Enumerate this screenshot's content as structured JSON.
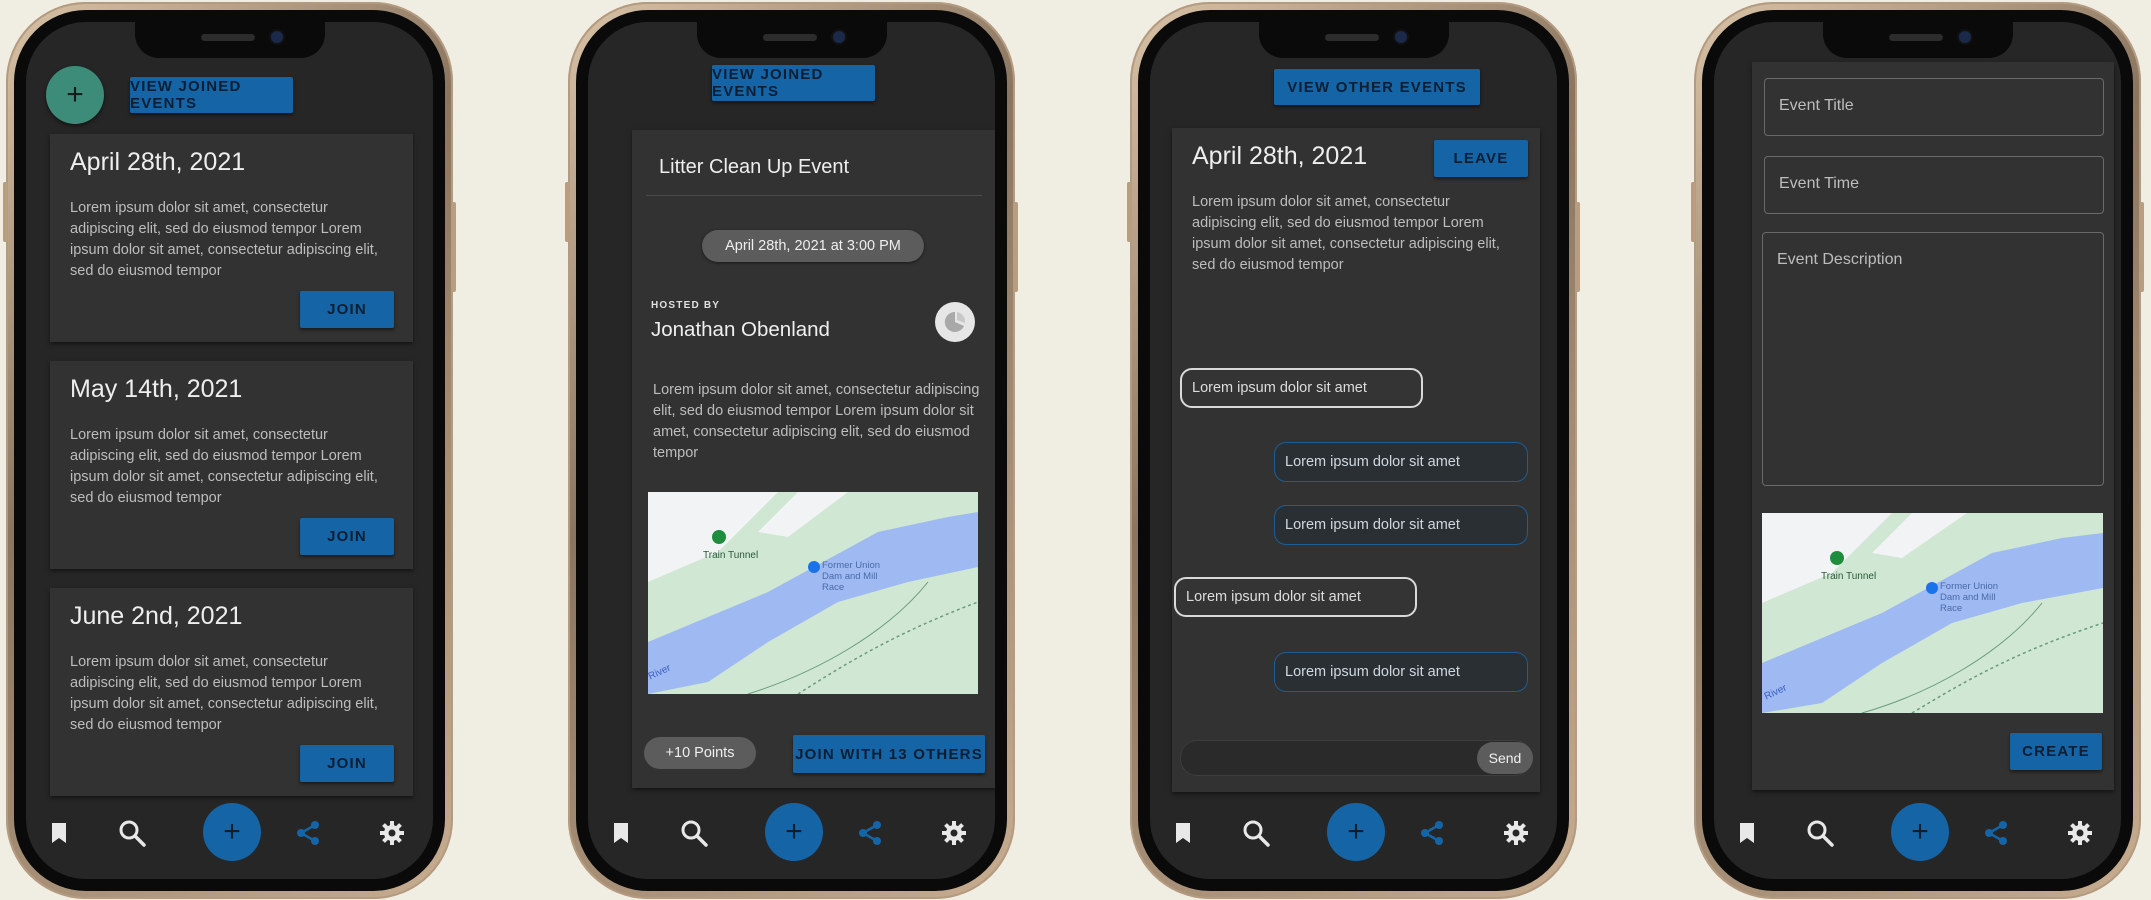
{
  "screen1": {
    "fab_icon": "+",
    "top_button": "VIEW JOINED EVENTS",
    "events": [
      {
        "date": "April 28th, 2021",
        "description": "Lorem ipsum dolor sit amet, consectetur adipiscing elit, sed do eiusmod tempor Lorem ipsum dolor sit amet, consectetur adipiscing elit, sed do eiusmod tempor",
        "button": "JOIN"
      },
      {
        "date": "May 14th, 2021",
        "description": "Lorem ipsum dolor sit amet, consectetur adipiscing elit, sed do eiusmod tempor Lorem ipsum dolor sit amet, consectetur adipiscing elit, sed do eiusmod tempor",
        "button": "JOIN"
      },
      {
        "date": "June 2nd, 2021",
        "description": "Lorem ipsum dolor sit amet, consectetur adipiscing elit, sed do eiusmod tempor Lorem ipsum dolor sit amet, consectetur adipiscing elit, sed do eiusmod tempor",
        "button": "JOIN"
      }
    ]
  },
  "screen2": {
    "top_button": "VIEW JOINED EVENTS",
    "event_title": "Litter Clean Up Event",
    "datetime_chip": "April 28th, 2021 at 3:00 PM",
    "hosted_by_label": "HOSTED BY",
    "host_name": "Jonathan Obenland",
    "description": "Lorem ipsum dolor sit amet, consectetur adipiscing elit, sed do eiusmod tempor Lorem ipsum dolor sit amet, consectetur adipiscing elit, sed do eiusmod tempor",
    "points_chip": "+10 Points",
    "join_button": "JOIN WITH 13 OTHERS"
  },
  "screen3": {
    "top_button": "VIEW OTHER EVENTS",
    "date": "April 28th, 2021",
    "leave_button": "LEAVE",
    "description": "Lorem ipsum dolor sit amet, consectetur adipiscing elit, sed do eiusmod tempor Lorem ipsum dolor sit amet, consectetur adipiscing elit, sed do eiusmod tempor",
    "messages": [
      {
        "side": "left",
        "text": "Lorem ipsum dolor sit amet"
      },
      {
        "side": "right",
        "text": "Lorem ipsum dolor sit amet"
      },
      {
        "side": "right",
        "text": "Lorem ipsum dolor sit amet"
      },
      {
        "side": "left",
        "text": "Lorem ipsum dolor sit amet"
      },
      {
        "side": "right",
        "text": "Lorem ipsum dolor sit amet"
      }
    ],
    "send_button": "Send"
  },
  "screen4": {
    "title_placeholder": "Event Title",
    "time_placeholder": "Event Time",
    "description_placeholder": "Event Description",
    "create_button": "CREATE"
  },
  "map": {
    "labels": [
      "Train Tunnel",
      "Former Union Dam and Mill Race",
      "River"
    ]
  },
  "nav_icons": [
    "bookmark-icon",
    "search-icon",
    "plus-icon",
    "share-icon",
    "gear-icon"
  ],
  "colors": {
    "accent": "#1565a6",
    "fab_green": "#3d8c7a",
    "background": "#262626",
    "card": "#323232",
    "page": "#f0ede3"
  }
}
